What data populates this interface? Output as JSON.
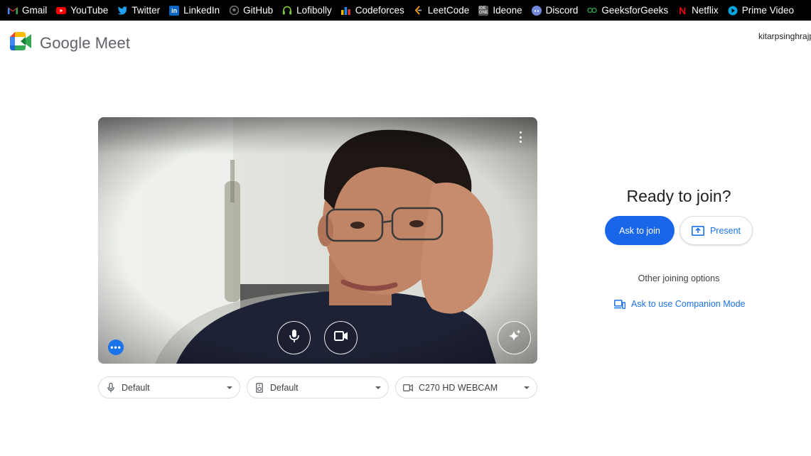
{
  "bookmarks": [
    {
      "label": "Gmail",
      "icon": "gmail-icon",
      "color": "#ea4335"
    },
    {
      "label": "YouTube",
      "icon": "youtube-icon",
      "color": "#ff0000"
    },
    {
      "label": "Twitter",
      "icon": "twitter-icon",
      "color": "#1da1f2"
    },
    {
      "label": "LinkedIn",
      "icon": "linkedin-icon",
      "color": "#0a66c2"
    },
    {
      "label": "GitHub",
      "icon": "github-icon",
      "color": "#444444"
    },
    {
      "label": "Lofibolly",
      "icon": "headphones-icon",
      "color": "#7ec242"
    },
    {
      "label": "Codeforces",
      "icon": "codeforces-icon",
      "color": "#f4b400"
    },
    {
      "label": "LeetCode",
      "icon": "leetcode-icon",
      "color": "#ffa116"
    },
    {
      "label": "Ideone",
      "icon": "ideone-icon",
      "color": "#9e9e9e"
    },
    {
      "label": "Discord",
      "icon": "discord-icon",
      "color": "#7289da"
    },
    {
      "label": "GeeksforGeeks",
      "icon": "geeksforgeeks-icon",
      "color": "#2f8d46"
    },
    {
      "label": "Netflix",
      "icon": "netflix-icon",
      "color": "#e50914"
    },
    {
      "label": "Prime Video",
      "icon": "prime-video-icon",
      "color": "#00a8e1"
    }
  ],
  "header": {
    "app_name": "Google Meet",
    "account": "kitarpsinghrajp"
  },
  "preview": {
    "more_options_icon": "more-vert-icon",
    "mic_icon": "mic-icon",
    "camera_icon": "videocam-icon",
    "effects_icon": "sparkle-icon",
    "dots_icon": "more-horiz-icon",
    "dots_color": "#1a73e8"
  },
  "devices": [
    {
      "label": "Default",
      "icon": "mic-icon"
    },
    {
      "label": "Default",
      "icon": "speaker-icon"
    },
    {
      "label": "C270 HD WEBCAM",
      "icon": "videocam-icon"
    }
  ],
  "join": {
    "title": "Ready to join?",
    "ask_label": "Ask to join",
    "present_label": "Present",
    "other_options": "Other joining options",
    "companion_label": "Ask to use Companion Mode",
    "accent": "#1a66e8"
  }
}
